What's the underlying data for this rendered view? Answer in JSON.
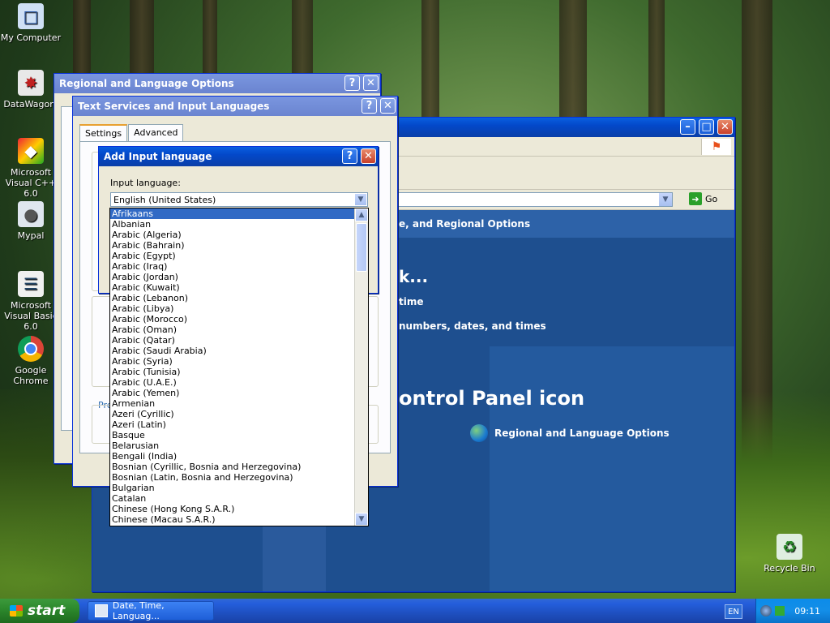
{
  "desktop": {
    "icons": [
      {
        "label": "My Computer"
      },
      {
        "label": "DataWagon."
      },
      {
        "label": "Microsoft Visual C++ 6.0"
      },
      {
        "label": "Mypal"
      },
      {
        "label": "Microsoft Visual Basic 6.0"
      },
      {
        "label": "Google Chrome"
      },
      {
        "label": "Recycle Bin"
      }
    ]
  },
  "control_panel": {
    "go_label": "Go",
    "heading_fragment": "e, and Regional Options",
    "task_fragment": "k...",
    "link_time": "time",
    "link_numbers": "numbers, dates, and times",
    "pick_icon": "ontrol Panel icon",
    "regional_link": "Regional and Language Options"
  },
  "regional_window": {
    "title": "Regional and Language Options"
  },
  "text_services": {
    "title": "Text Services and Input Languages",
    "tabs": [
      "Settings",
      "Advanced"
    ],
    "pref_fragment": "Pre"
  },
  "add_input": {
    "title": "Add Input language",
    "input_label": "Input language:",
    "selected_value": "English (United States)",
    "options": [
      "Afrikaans",
      "Albanian",
      "Arabic (Algeria)",
      "Arabic (Bahrain)",
      "Arabic (Egypt)",
      "Arabic (Iraq)",
      "Arabic (Jordan)",
      "Arabic (Kuwait)",
      "Arabic (Lebanon)",
      "Arabic (Libya)",
      "Arabic (Morocco)",
      "Arabic (Oman)",
      "Arabic (Qatar)",
      "Arabic (Saudi Arabia)",
      "Arabic (Syria)",
      "Arabic (Tunisia)",
      "Arabic (U.A.E.)",
      "Arabic (Yemen)",
      "Armenian",
      "Azeri (Cyrillic)",
      "Azeri (Latin)",
      "Basque",
      "Belarusian",
      "Bengali (India)",
      "Bosnian (Cyrillic, Bosnia and Herzegovina)",
      "Bosnian (Latin, Bosnia and Herzegovina)",
      "Bulgarian",
      "Catalan",
      "Chinese (Hong Kong S.A.R.)",
      "Chinese (Macau S.A.R.)"
    ],
    "highlighted_index": 0
  },
  "taskbar": {
    "start_label": "start",
    "task_label": "Date, Time, Languag...",
    "lang_indicator": "EN",
    "clock": "09:11"
  },
  "colors": {
    "title_blue": "#0a5fe0",
    "cp_blue": "#1e4f8f",
    "selection": "#316ac5"
  }
}
